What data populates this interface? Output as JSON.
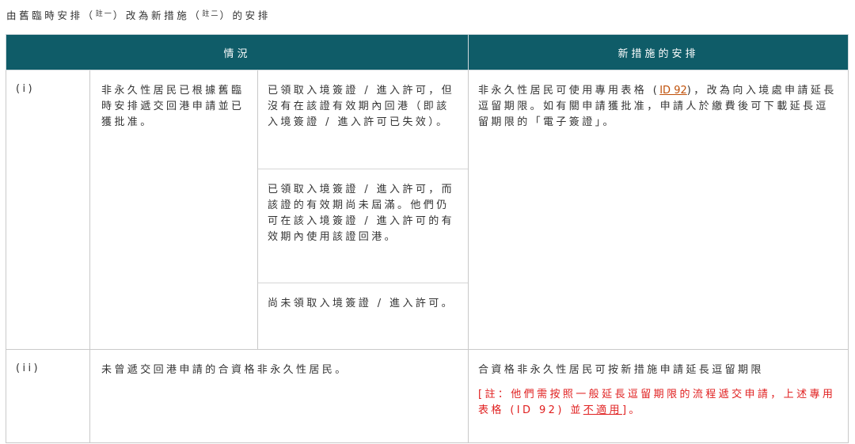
{
  "caption": {
    "part1": "由舊臨時安排（",
    "note1": "註一",
    "part2": "）改為新措施（",
    "note2": "註二",
    "part3": "）的安排"
  },
  "table": {
    "headers": {
      "situation": "情況",
      "arrangement": "新措施的安排"
    },
    "rows": [
      {
        "index": "(i)",
        "condition": "非永久性居民已根據舊臨時安排遞交回港申請並已獲批准。",
        "subs": [
          "已領取入境簽證 / 進入許可，但沒有在該證有效期內回港（即該入境簽證 / 進入許可已失效）。",
          "已領取入境簽證 / 進入許可，而該證的有效期尚未屆滿。他們仍可在該入境簽證 / 進入許可的有效期內使用該證回港。",
          "尚未領取入境簽證 / 進入許可。"
        ],
        "arrangement": {
          "before": "非永久性居民可使用專用表格 (",
          "link": "ID 92",
          "after": ")，改為向入境處申請延長逗留期限。如有關申請獲批准，申請人於繳費後可下載延長逗留期限的「電子簽證」。"
        }
      },
      {
        "index": "(ii)",
        "condition": "未曾遞交回港申請的合資格非永久性居民。",
        "arrangement": {
          "main": "合資格非永久性居民可按新措施申請延長逗留期限",
          "note_before": "[註：他們需按照一般延長逗留期限的流程遞交申請，上述專用表格 (ID 92) 並",
          "note_underlined": "不適用",
          "note_after": "]。"
        }
      }
    ]
  },
  "colors": {
    "header_bg": "#0f5c68",
    "link": "#c0510a",
    "note": "#e02020"
  }
}
